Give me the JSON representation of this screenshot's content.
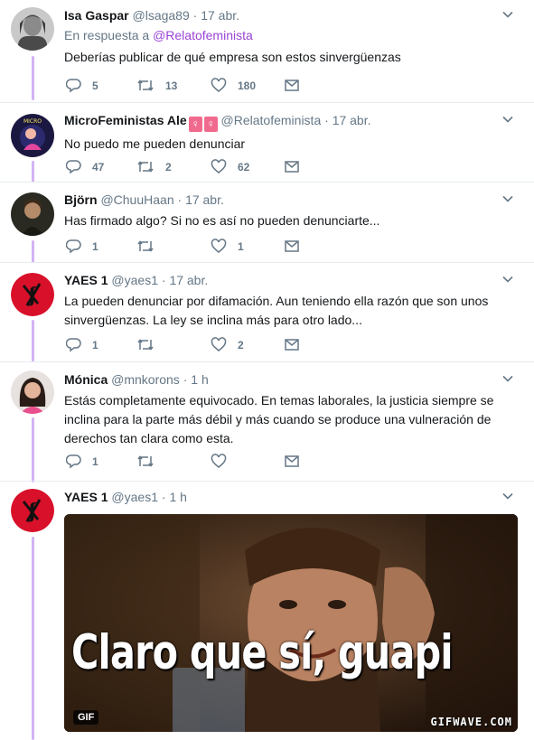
{
  "colors": {
    "accent": "#9b44d6",
    "thread_line": "#d3b3f5",
    "muted": "#657786",
    "text": "#14171a",
    "divider": "#e6ecf0"
  },
  "tweets": [
    {
      "name": "Isa Gaspar",
      "handle": "@lsaga89",
      "time": "17 abr.",
      "reply_prefix": "En respuesta a",
      "reply_mention": "@Relatofeminista",
      "text": "Deberías publicar de qué empresa son estos sinvergüenzas",
      "replies": "5",
      "retweets": "13",
      "likes": "180"
    },
    {
      "name": "MicroFeministas Ale",
      "name_emoji": "♀",
      "handle": "@Relatofeminista",
      "time": "17 abr.",
      "text": "No puedo me pueden denunciar",
      "replies": "47",
      "retweets": "2",
      "likes": "62"
    },
    {
      "name": "Björn",
      "handle": "@ChuuHaan",
      "time": "17 abr.",
      "text": "Has firmado algo? Si no es así no pueden denunciarte...",
      "replies": "1",
      "retweets": "",
      "likes": "1"
    },
    {
      "name": "YAES 1",
      "handle": "@yaes1",
      "time": "17 abr.",
      "text_line1": "La pueden denunciar por difamación. Aun teniendo ella razón que son unos",
      "text_line2": "sinvergüenzas. La ley se inclina más para otro lado...",
      "replies": "1",
      "retweets": "",
      "likes": "2"
    },
    {
      "name": "Mónica",
      "handle": "@mnkorons",
      "time": "1 h",
      "text_line1": "Estás completamente equivocado. En temas laborales, la justicia siempre se",
      "text_line2": "inclina para la parte más débil y más cuando se produce una vulneración de",
      "text_line3": "derechos tan clara como esta.",
      "replies": "1",
      "retweets": "",
      "likes": ""
    },
    {
      "name": "YAES 1",
      "handle": "@yaes1",
      "time": "1 h",
      "gif_caption": "Claro que sí, guapi",
      "gif_badge": "GIF",
      "gif_watermark": "GIFWAVE.COM"
    }
  ],
  "icons": {
    "reply": "reply-icon",
    "retweet": "retweet-icon",
    "like": "heart-icon",
    "dm": "envelope-icon",
    "menu": "chevron-down-icon"
  }
}
